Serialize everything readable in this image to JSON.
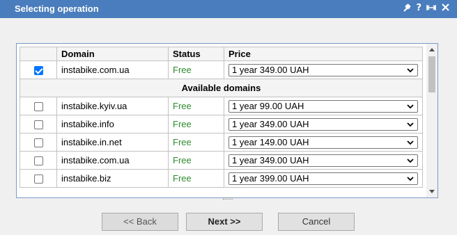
{
  "window": {
    "title": "Selecting operation"
  },
  "titlebar_icons": [
    "pin-icon",
    "help-icon",
    "maximize-icon",
    "close-icon"
  ],
  "table": {
    "headers": [
      "",
      "Domain",
      "Status",
      "Price"
    ],
    "selected": [
      {
        "checked": true,
        "domain": "instabike.com.ua",
        "status": "Free",
        "price": "1 year 349.00 UAH"
      }
    ],
    "group_label": "Available domains",
    "available": [
      {
        "checked": false,
        "domain": "instabike.kyiv.ua",
        "status": "Free",
        "price": "1 year 99.00 UAH"
      },
      {
        "checked": false,
        "domain": "instabike.info",
        "status": "Free",
        "price": "1 year 349.00 UAH"
      },
      {
        "checked": false,
        "domain": "instabike.in.net",
        "status": "Free",
        "price": "1 year 149.00 UAH"
      },
      {
        "checked": false,
        "domain": "instabike.com.ua",
        "status": "Free",
        "price": "1 year 349.00 UAH"
      },
      {
        "checked": false,
        "domain": "instabike.biz",
        "status": "Free",
        "price": "1 year 399.00 UAH"
      }
    ]
  },
  "buttons": {
    "back": "<< Back",
    "next": "Next >>",
    "cancel": "Cancel"
  },
  "colors": {
    "titlebar": "#4a7dbd",
    "status_free": "#2e8b2e",
    "checkbox_checked": "#0075ff"
  }
}
